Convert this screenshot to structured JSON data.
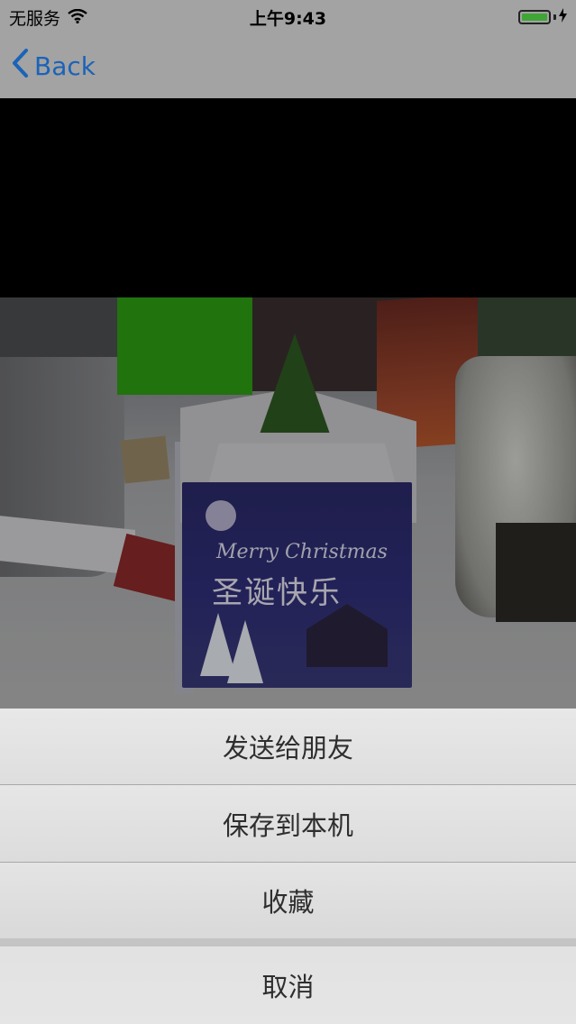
{
  "status_bar": {
    "carrier": "无服务",
    "time": "上午9:43",
    "battery_level": 1.0,
    "icons": [
      "wifi-icon",
      "battery-icon",
      "charging-bolt-icon"
    ]
  },
  "nav": {
    "back_label": "Back",
    "accent_color": "#1a63b8"
  },
  "photo": {
    "printed_text_large": "圣诞快乐",
    "printed_text_small": "Merry Christmas"
  },
  "action_sheet": {
    "items": [
      {
        "label": "发送给朋友"
      },
      {
        "label": "保存到本机"
      },
      {
        "label": "收藏"
      }
    ],
    "cancel_label": "取消"
  }
}
